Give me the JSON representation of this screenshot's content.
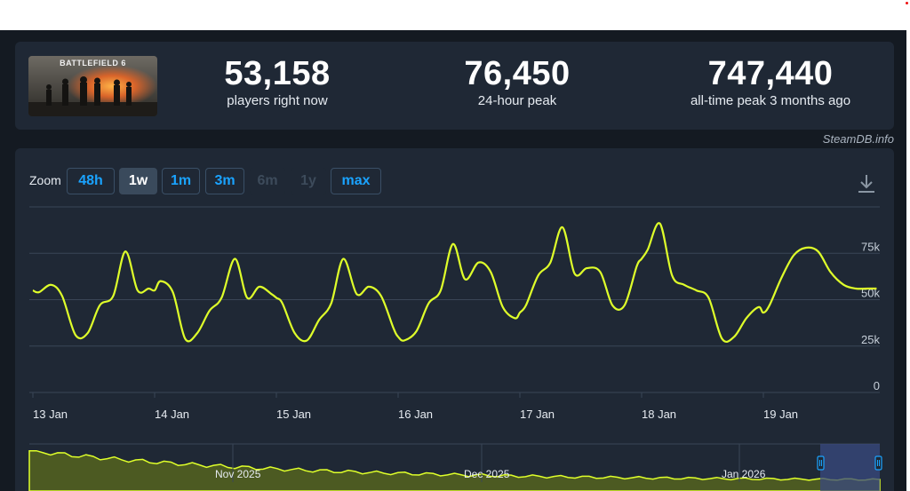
{
  "stats": {
    "game_title": "BATTLEFIELD 6",
    "current_players": "53,158",
    "current_label": "players right now",
    "peak_24h": "76,450",
    "peak_24h_label": "24-hour peak",
    "all_time_peak": "747,440",
    "all_time_label": "all-time peak 3 months ago"
  },
  "credit": "SteamDB.info",
  "zoom": {
    "label": "Zoom",
    "buttons": [
      {
        "label": "48h",
        "state": "normal"
      },
      {
        "label": "1w",
        "state": "active"
      },
      {
        "label": "1m",
        "state": "normal"
      },
      {
        "label": "3m",
        "state": "normal"
      },
      {
        "label": "6m",
        "state": "disabled"
      },
      {
        "label": "1y",
        "state": "disabled"
      },
      {
        "label": "max",
        "state": "normal"
      }
    ]
  },
  "icons": {
    "download": "download-icon"
  },
  "colors": {
    "line": "#dfff2a",
    "accent": "#1aa3ff",
    "navigator_fill": "#4c5a22",
    "navigator_selection": "#3a4a80"
  },
  "chart_data": {
    "type": "line",
    "x_tick_labels": [
      "13 Jan",
      "14 Jan",
      "15 Jan",
      "16 Jan",
      "17 Jan",
      "18 Jan",
      "19 Jan"
    ],
    "y_tick_labels": [
      "0",
      "25k",
      "50k",
      "75k"
    ],
    "ylim": [
      0,
      100000
    ],
    "y_axis_position": "right",
    "grid": true,
    "series": [
      {
        "x": [
          0,
          0.05,
          0.15,
          0.24,
          0.35,
          0.45,
          0.55,
          0.66,
          0.76,
          0.86,
          0.95,
          1.0,
          1.05,
          1.15,
          1.25,
          1.35,
          1.45,
          1.55,
          1.66,
          1.76,
          1.86,
          1.96,
          2.0,
          2.05,
          2.15,
          2.25,
          2.35,
          2.45,
          2.55,
          2.66,
          2.76,
          2.86,
          2.96,
          3.0,
          3.05,
          3.15,
          3.25,
          3.35,
          3.45,
          3.55,
          3.66,
          3.76,
          3.86,
          3.96,
          4.0,
          4.05,
          4.15,
          4.25,
          4.35,
          4.45,
          4.55,
          4.66,
          4.76,
          4.86,
          4.96,
          5.0,
          5.05,
          5.15,
          5.25,
          5.35,
          5.45,
          5.55,
          5.66,
          5.76,
          5.86,
          5.96,
          6.0,
          6.05,
          6.15,
          6.25,
          6.35,
          6.45,
          6.55,
          6.66,
          6.76,
          6.86,
          6.93
        ],
        "values": [
          55000,
          54000,
          58000,
          52000,
          31000,
          32000,
          47000,
          52000,
          76000,
          55000,
          56000,
          55000,
          60000,
          54000,
          29000,
          32000,
          44000,
          51000,
          72000,
          51000,
          57000,
          53000,
          51000,
          48000,
          32000,
          28000,
          39000,
          48000,
          72000,
          53000,
          57000,
          52000,
          35000,
          30000,
          28000,
          33000,
          48000,
          55000,
          80000,
          61000,
          70000,
          65000,
          46000,
          40000,
          43000,
          47000,
          63000,
          70000,
          89000,
          64000,
          67000,
          65000,
          47000,
          47000,
          68000,
          72000,
          77000,
          91000,
          63000,
          58000,
          55000,
          51000,
          29000,
          30000,
          40000,
          46000,
          43000,
          47000,
          62000,
          74000,
          78000,
          76000,
          65000,
          58000,
          56000,
          56000,
          56000
        ]
      }
    ],
    "navigator": {
      "labels": [
        "Nov 2025",
        "Dec 2025",
        "Jan 2026"
      ]
    }
  }
}
